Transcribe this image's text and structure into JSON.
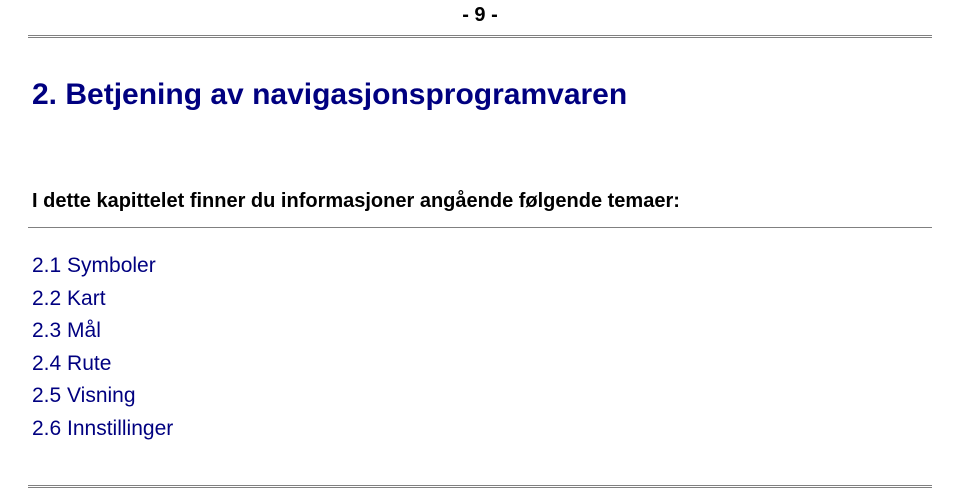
{
  "page_number": "- 9 -",
  "chapter": {
    "heading": "2. Betjening av navigasjonsprogramvaren",
    "intro": "I dette kapittelet finner du informasjoner angående følgende temaer:"
  },
  "toc": [
    {
      "label": "2.1 Symboler"
    },
    {
      "label": "2.2 Kart"
    },
    {
      "label": "2.3 Mål"
    },
    {
      "label": "2.4 Rute"
    },
    {
      "label": "2.5 Visning"
    },
    {
      "label": "2.6 Innstillinger"
    }
  ]
}
